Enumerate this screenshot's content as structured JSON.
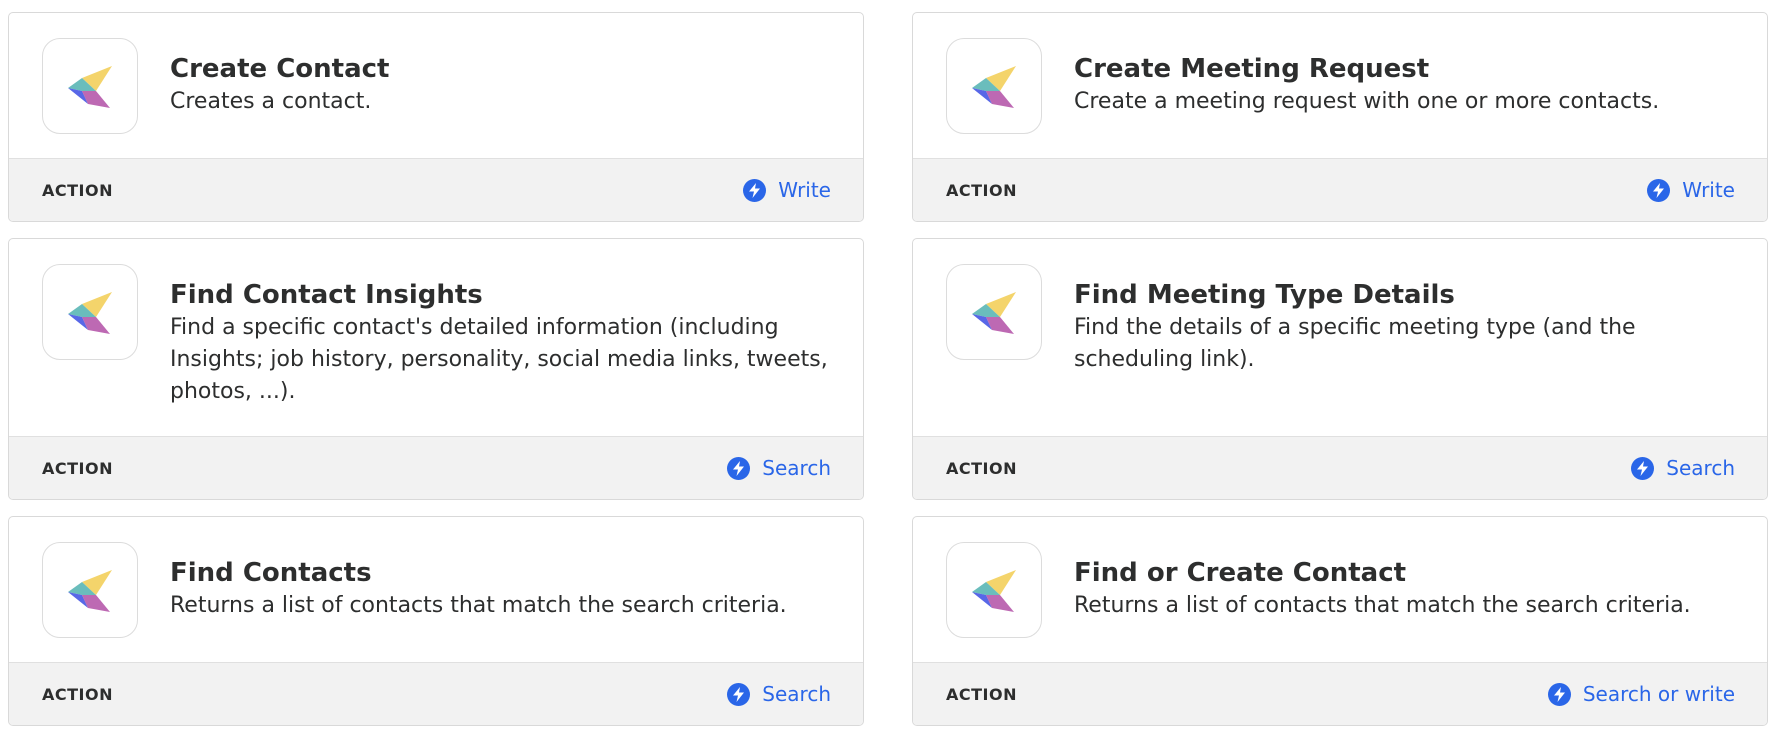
{
  "colors": {
    "accent": "#2a66e8",
    "footer_bg": "#f2f2f2",
    "logo_yellow": "#f3cf5b",
    "logo_teal": "#5ab6b5",
    "logo_blue": "#4656e4",
    "logo_magenta": "#b14fa6"
  },
  "cards": [
    {
      "title": "Create Contact",
      "description": "Creates a contact.",
      "type_label": "ACTION",
      "action": {
        "icon": "lightning-bolt-icon",
        "label": "Write"
      }
    },
    {
      "title": "Create Meeting Request",
      "description": "Create a meeting request with one or more contacts.",
      "type_label": "ACTION",
      "action": {
        "icon": "lightning-bolt-icon",
        "label": "Write"
      }
    },
    {
      "title": "Find Contact Insights",
      "description": "Find a specific contact's detailed information (including Insights; job history, personality, social media links, tweets, photos, ...).",
      "type_label": "ACTION",
      "action": {
        "icon": "lightning-bolt-icon",
        "label": "Search"
      }
    },
    {
      "title": "Find Meeting Type Details",
      "description": "Find the details of a specific meeting type (and the scheduling link).",
      "type_label": "ACTION",
      "action": {
        "icon": "lightning-bolt-icon",
        "label": "Search"
      }
    },
    {
      "title": "Find Contacts",
      "description": "Returns a list of contacts that match the search criteria.",
      "type_label": "ACTION",
      "action": {
        "icon": "lightning-bolt-icon",
        "label": "Search"
      }
    },
    {
      "title": "Find or Create Contact",
      "description": "Returns a list of contacts that match the search criteria.",
      "type_label": "ACTION",
      "action": {
        "icon": "lightning-bolt-icon",
        "label": "Search or write"
      }
    }
  ]
}
